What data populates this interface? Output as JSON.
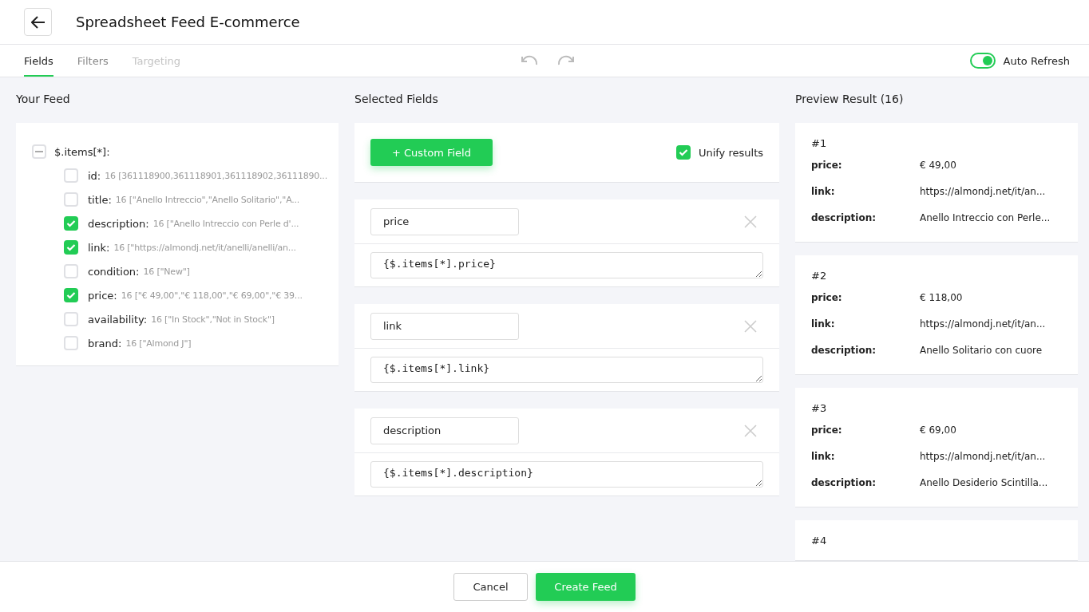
{
  "header": {
    "title": "Spreadsheet Feed E-commerce"
  },
  "tabs": [
    {
      "label": "Fields",
      "selected": true,
      "disabled": false
    },
    {
      "label": "Filters",
      "selected": false,
      "disabled": false
    },
    {
      "label": "Targeting",
      "selected": false,
      "disabled": true
    }
  ],
  "auto_refresh": {
    "label": "Auto Refresh",
    "on": true
  },
  "your_feed": {
    "title": "Your Feed",
    "root": {
      "label": "$.items[*]:",
      "expanded": true,
      "children": [
        {
          "name": "id:",
          "sample": "16 [361118900,361118901,361118902,36111890...",
          "checked": false
        },
        {
          "name": "title:",
          "sample": "16 [\"Anello Intreccio\",\"Anello Solitario\",\"A...",
          "checked": false
        },
        {
          "name": "description:",
          "sample": "16 [\"Anello Intreccio con Perle d'...",
          "checked": true
        },
        {
          "name": "link:",
          "sample": "16 [\"https://almondj.net/it/anelli/anelli/an...",
          "checked": true
        },
        {
          "name": "condition:",
          "sample": "16 [\"New\"]",
          "checked": false
        },
        {
          "name": "price:",
          "sample": "16 [\"€ 49,00\",\"€ 118,00\",\"€ 69,00\",\"€ 39...",
          "checked": true
        },
        {
          "name": "availability:",
          "sample": "16 [\"In Stock\",\"Not in Stock\"]",
          "checked": false
        },
        {
          "name": "brand:",
          "sample": "16 [\"Almond J\"]",
          "checked": false
        }
      ]
    }
  },
  "selected_fields": {
    "title": "Selected Fields",
    "custom_button": "+ Custom Field",
    "unify": {
      "label": "Unify results",
      "checked": true
    },
    "fields": [
      {
        "name": "price",
        "expression": "{$.items[*].price}"
      },
      {
        "name": "link",
        "expression": "{$.items[*].link}"
      },
      {
        "name": "description",
        "expression": "{$.items[*].description}"
      }
    ]
  },
  "preview": {
    "title": "Preview Result (16)",
    "results": [
      {
        "number": "#1",
        "rows": [
          {
            "label": "price:",
            "value": "€ 49,00"
          },
          {
            "label": "link:",
            "value": "https://almondj.net/it/an..."
          },
          {
            "label": "description:",
            "value": "Anello Intreccio con Perle..."
          }
        ]
      },
      {
        "number": "#2",
        "rows": [
          {
            "label": "price:",
            "value": "€ 118,00"
          },
          {
            "label": "link:",
            "value": "https://almondj.net/it/an..."
          },
          {
            "label": "description:",
            "value": "Anello Solitario con cuore"
          }
        ]
      },
      {
        "number": "#3",
        "rows": [
          {
            "label": "price:",
            "value": "€ 69,00"
          },
          {
            "label": "link:",
            "value": "https://almondj.net/it/an..."
          },
          {
            "label": "description:",
            "value": "Anello Desiderio Scintilla..."
          }
        ]
      },
      {
        "number": "#4"
      }
    ]
  },
  "footer": {
    "cancel": "Cancel",
    "create": "Create Feed"
  }
}
